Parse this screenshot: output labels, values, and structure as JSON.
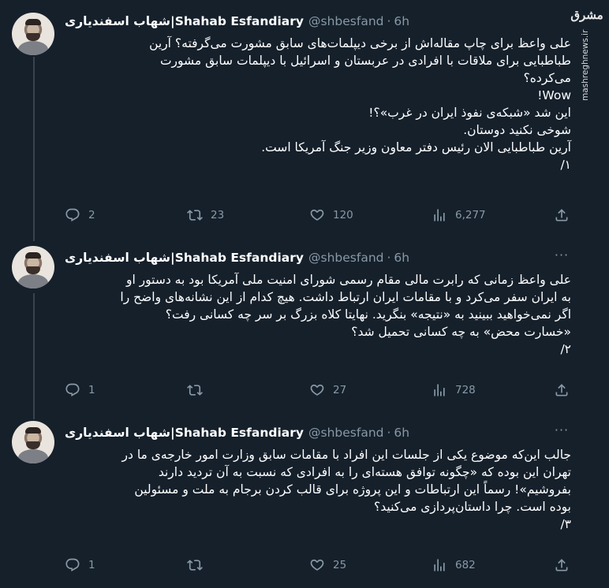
{
  "watermark": {
    "logo_text": "مشرق",
    "site": "mashreghnews.ir"
  },
  "author": {
    "name": "شهاب اسفندیاری|Shahab Esfandiary",
    "handle": "@shbesfand",
    "separator": "·"
  },
  "tweets": [
    {
      "time": "6h",
      "text": "علی واعظ برای چاپ مقاله‌اش از برخی دیپلمات‌های سابق مشورت می‌گرفته؟ آرین\nطباطبایی برای ملاقات با افرادی در عربستان و اسرائیل با دیپلمات سابق مشورت\nمی‌کرده؟\nWow!\nاین شد «شبکه‌ی نفوذ ایران در غرب»؟!\nشوخی نکنید دوستان.\nآرین طباطبایی الان رئیس دفتر معاون وزیر جنگ آمریکا است.\n۱/",
      "replies": "2",
      "retweets": "23",
      "likes": "120",
      "views": "6,277"
    },
    {
      "time": "6h",
      "text": "علی واعظ زمانی که رابرت مالی مقام رسمی شورای امنیت ملی آمریکا بود به دستور او\nبه ایران سفر می‌کرد و با مقامات ایران ارتباط داشت. هیچ کدام از این نشانه‌های واضح را\nاگر نمی‌خواهید ببینید به «نتیجه» بنگرید. نهایتا کلاه بزرگ بر سر چه کسانی رفت؟\n«خسارت محض» به چه کسانی تحمیل شد؟\n۲/",
      "replies": "1",
      "retweets": "",
      "likes": "27",
      "views": "728"
    },
    {
      "time": "6h",
      "text": "جالب این‌که موضوع یکی از جلسات این افراد با مقامات سابق وزارت امور خارجه‌ی ما در\nتهران این بوده که «چگونه توافق هسته‌ای را به افرادی که نسبت به آن تردید دارند\nبفروشیم»! رسماً این ارتباطات و این پروژه برای قالب کردن برجام به ملت و مسئولین\nبوده است. چرا داستان‌پردازی می‌کنید؟\n۳/",
      "replies": "1",
      "retweets": "",
      "likes": "25",
      "views": "682"
    }
  ],
  "icons": {
    "reply": "reply-icon",
    "retweet": "retweet-icon",
    "like": "like-icon",
    "views": "views-icon",
    "share": "share-icon",
    "more": "more-icon"
  },
  "colors": {
    "background": "#15202b",
    "muted": "#8899a6",
    "text": "#ffffff",
    "thread": "#38444d"
  }
}
